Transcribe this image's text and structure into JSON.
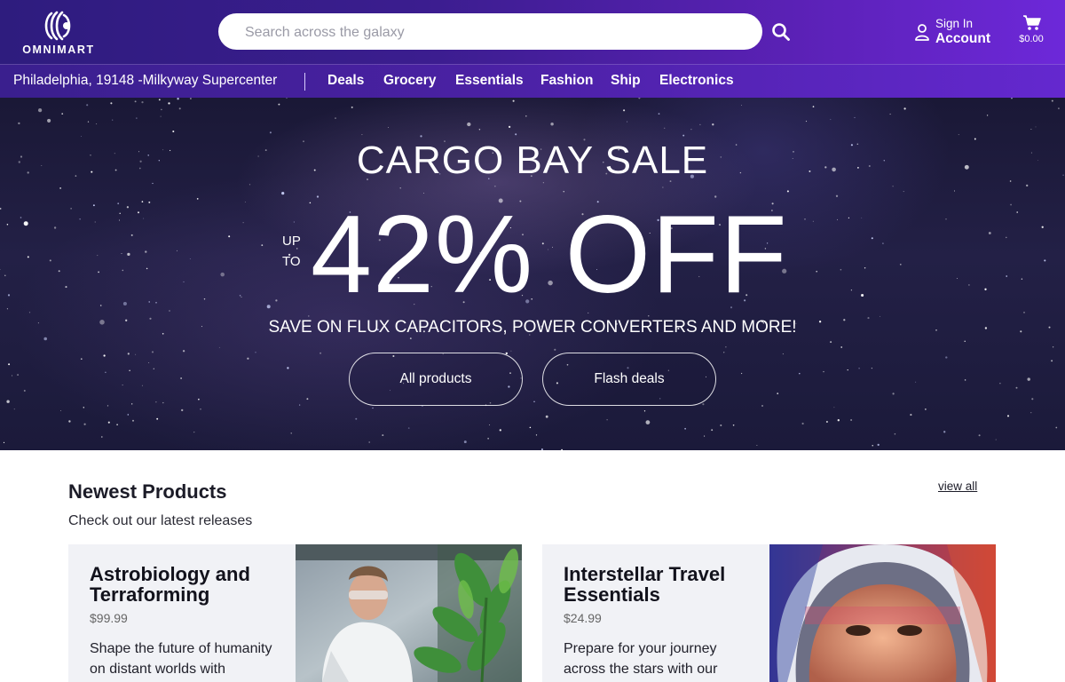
{
  "header": {
    "logo_text": "OMNIMART",
    "search": {
      "placeholder": "Search across the galaxy"
    },
    "account": {
      "sign_in": "Sign In",
      "label": "Account"
    },
    "cart": {
      "total": "$0.00"
    },
    "icons": {
      "logo": "omnimart-logo",
      "search": "search-icon",
      "user": "user-icon",
      "cart": "cart-icon"
    }
  },
  "nav": {
    "location": "Philadelphia, 19148 -Milkyway Supercenter",
    "items": [
      "Deals",
      "Grocery",
      "Essentials",
      "Fashion",
      "Ship",
      "Electronics"
    ]
  },
  "hero": {
    "title": "CARGO BAY SALE",
    "up": "UP",
    "to": "TO",
    "discount": "42% OFF",
    "subtitle": "SAVE ON FLUX CAPACITORS, POWER CONVERTERS AND MORE!",
    "buttons": [
      "All products",
      "Flash deals"
    ]
  },
  "products": {
    "title": "Newest Products",
    "subtitle": "Check out our latest releases",
    "view_all": "view all",
    "items": [
      {
        "title": "Astrobiology and Terraforming",
        "price": "$99.99",
        "description": "Shape the future of humanity on distant worlds with"
      },
      {
        "title": "Interstellar Travel Essentials",
        "price": "$24.99",
        "description": "Prepare for your journey across the stars with our"
      }
    ]
  },
  "colors": {
    "header_start": "#2e1c7e",
    "header_end": "#6d28d9",
    "hero_bg": "#1e1c3e",
    "card_bg": "#f1f2f6"
  }
}
